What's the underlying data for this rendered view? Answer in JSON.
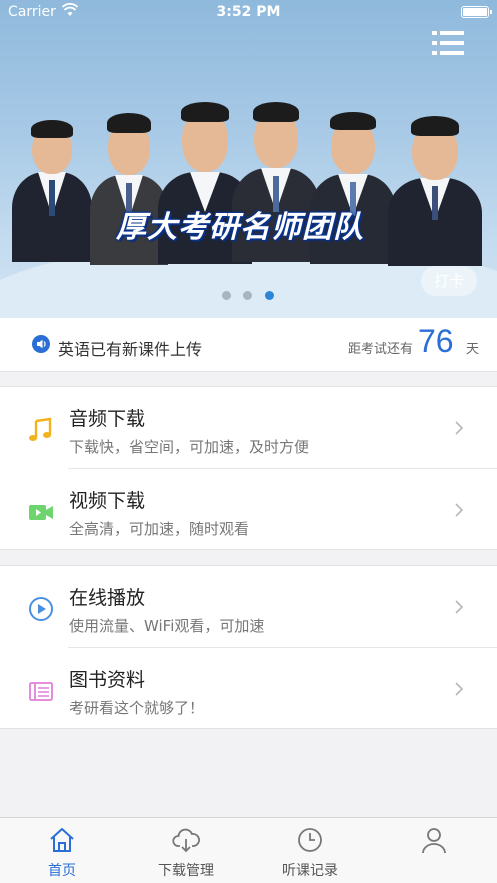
{
  "status_bar": {
    "carrier": "Carrier",
    "time": "3:52 PM"
  },
  "banner": {
    "title": "厚大考研名师团队",
    "checkin_label": "打卡",
    "page_count": 3,
    "active_page": 3
  },
  "notice": {
    "text": "英语已有新课件上传",
    "countdown_prefix": "距考试还有",
    "countdown_value": "76",
    "countdown_unit": "天"
  },
  "menu_groups": [
    {
      "items": [
        {
          "title": "音频下载",
          "subtitle": "下载快，省空间，可加速，及时方便",
          "icon": "music-note-icon",
          "color": "#f2b21b"
        },
        {
          "title": "视频下载",
          "subtitle": "全高清，可加速，随时观看",
          "icon": "video-camera-icon",
          "color": "#6ed46e"
        }
      ]
    },
    {
      "items": [
        {
          "title": "在线播放",
          "subtitle": "使用流量、WiFi观看，可加速",
          "icon": "play-circle-icon",
          "color": "#4a90e2"
        },
        {
          "title": "图书资料",
          "subtitle": "考研看这个就够了！",
          "icon": "book-icon",
          "color": "#e07fd8"
        }
      ]
    }
  ],
  "tabbar": {
    "tabs": [
      {
        "label": "首页",
        "icon": "home-icon",
        "active": true
      },
      {
        "label": "下载管理",
        "icon": "cloud-download-icon",
        "active": false
      },
      {
        "label": "听课记录",
        "icon": "clock-icon",
        "active": false
      },
      {
        "label": "",
        "icon": "user-icon",
        "active": false
      }
    ]
  },
  "colors": {
    "accent": "#2a6fd6",
    "banner_top": "#8fb9dc",
    "banner_bottom": "#d3e5f3",
    "background": "#f2f2f4"
  }
}
